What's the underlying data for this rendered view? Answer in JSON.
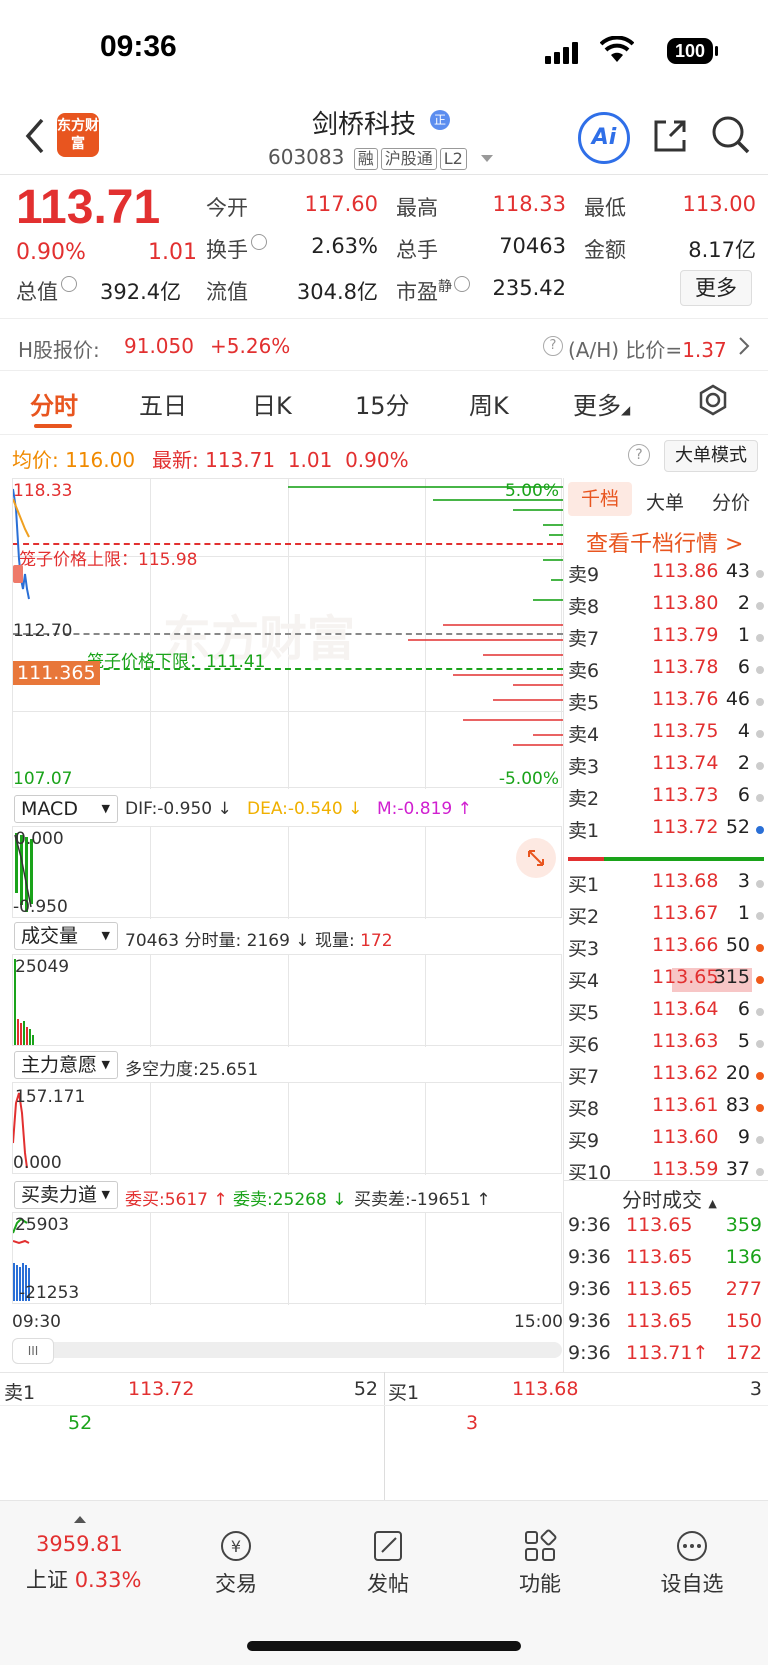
{
  "status": {
    "time": "09:36",
    "battery": "100"
  },
  "header": {
    "stock_name": "剑桥科技",
    "reg_badge": "正",
    "code": "603083",
    "tags": [
      "融",
      "沪股通",
      "L2"
    ],
    "logo_text": "东方财富",
    "ai_label": "Ai"
  },
  "quote": {
    "price": "113.71",
    "pct": "0.90%",
    "chg": "1.01",
    "open_label": "今开",
    "open": "117.60",
    "high_label": "最高",
    "high": "118.33",
    "low_label": "最低",
    "low": "113.00",
    "turn_label": "换手",
    "turn": "2.63%",
    "vol_label": "总手",
    "vol": "70463",
    "amt_label": "金额",
    "amt": "8.17亿",
    "mcap_label": "总值",
    "mcap": "392.4亿",
    "float_label": "流值",
    "float": "304.8亿",
    "pe_label": "市盈",
    "pe_sup": "静",
    "pe": "235.42",
    "more": "更多"
  },
  "hshare": {
    "label": "H股报价:",
    "price": "91.050",
    "pct": "+5.26%",
    "ratio_label": "(A/H) 比价=",
    "ratio": "1.37"
  },
  "tabs": [
    "分时",
    "五日",
    "日K",
    "15分",
    "周K",
    "更多"
  ],
  "chart": {
    "avg_label": "均价:",
    "avg": "116.00",
    "latest_label": "最新:",
    "latest": "113.71",
    "latest_chg": "1.01",
    "latest_pct": "0.90%",
    "mode_button": "大单模式",
    "y_max": "118.33",
    "y_mid": "112.70",
    "y_min": "107.07",
    "pct_max": "5.00%",
    "pct_min": "-5.00%",
    "upper_limit_text": "笼子价格上限：115.98",
    "lower_limit_text": "笼子价格下限：111.41",
    "cursor_price": "111.365",
    "watermark": "东方财富",
    "time_start": "09:30",
    "time_end": "15:00"
  },
  "macd": {
    "name": "MACD",
    "dif": "DIF:-0.950 ↓",
    "dea": "DEA:-0.540 ↓",
    "m": "M:-0.819 ↑",
    "top": "0.000",
    "bottom": "-0.950"
  },
  "volume": {
    "name": "成交量",
    "total": "70463",
    "min_vol": "分时量: 2169 ↓",
    "cur_label": "现量:",
    "cur": "172",
    "top": "25049"
  },
  "main_force": {
    "name": "主力意愿",
    "text": "多空力度:25.651",
    "top": "157.171",
    "bottom": "0.000"
  },
  "bid_ask_force": {
    "name": "买卖力道",
    "buy": "委买:5617 ↑",
    "sell": "委卖:25268 ↓",
    "diff": "买卖差:-19651 ↑",
    "top": "25903",
    "bottom": "-21253"
  },
  "orderbook": {
    "tabs": [
      "千档",
      "大单",
      "分价"
    ],
    "view_link": "查看千档行情 >",
    "asks": [
      {
        "label": "卖9",
        "price": "113.86",
        "vol": "43",
        "dot": "#cccccc"
      },
      {
        "label": "卖8",
        "price": "113.80",
        "vol": "2",
        "dot": "#cccccc"
      },
      {
        "label": "卖7",
        "price": "113.79",
        "vol": "1",
        "dot": "#cccccc"
      },
      {
        "label": "卖6",
        "price": "113.78",
        "vol": "6",
        "dot": "#cccccc"
      },
      {
        "label": "卖5",
        "price": "113.76",
        "vol": "46",
        "dot": "#cccccc"
      },
      {
        "label": "卖4",
        "price": "113.75",
        "vol": "4",
        "dot": "#cccccc"
      },
      {
        "label": "卖3",
        "price": "113.74",
        "vol": "2",
        "dot": "#cccccc"
      },
      {
        "label": "卖2",
        "price": "113.73",
        "vol": "6",
        "dot": "#cccccc"
      },
      {
        "label": "卖1",
        "price": "113.72",
        "vol": "52",
        "dot": "#2a6fd6"
      }
    ],
    "bids": [
      {
        "label": "买1",
        "price": "113.68",
        "vol": "3",
        "dot": "#cccccc"
      },
      {
        "label": "买2",
        "price": "113.67",
        "vol": "1",
        "dot": "#cccccc"
      },
      {
        "label": "买3",
        "price": "113.66",
        "vol": "50",
        "dot": "#f05a1a"
      },
      {
        "label": "买4",
        "price": "113.65",
        "vol": "315",
        "dot": "#f05a1a"
      },
      {
        "label": "买5",
        "price": "113.64",
        "vol": "6",
        "dot": "#cccccc"
      },
      {
        "label": "买6",
        "price": "113.63",
        "vol": "5",
        "dot": "#cccccc"
      },
      {
        "label": "买7",
        "price": "113.62",
        "vol": "20",
        "dot": "#f05a1a"
      },
      {
        "label": "买8",
        "price": "113.61",
        "vol": "83",
        "dot": "#f05a1a"
      },
      {
        "label": "买9",
        "price": "113.60",
        "vol": "9",
        "dot": "#cccccc"
      },
      {
        "label": "买10",
        "price": "113.59",
        "vol": "37",
        "dot": "#cccccc"
      }
    ],
    "trades_title": "分时成交",
    "trades": [
      {
        "time": "9:36",
        "price": "113.65",
        "vol": "359",
        "color": "#1aa31a"
      },
      {
        "time": "9:36",
        "price": "113.65",
        "vol": "136",
        "color": "#1aa31a"
      },
      {
        "time": "9:36",
        "price": "113.65",
        "vol": "277",
        "color": "#e23030"
      },
      {
        "time": "9:36",
        "price": "113.65",
        "vol": "150",
        "color": "#e23030"
      },
      {
        "time": "9:36",
        "price": "113.71↑",
        "vol": "172",
        "color": "#e23030"
      }
    ]
  },
  "bottom_quote": {
    "sell_label": "卖1",
    "sell_price": "113.72",
    "sell_vol": "52",
    "buy_label": "买1",
    "buy_price": "113.68",
    "buy_vol": "3",
    "sell_queue": "52",
    "buy_queue": "3"
  },
  "nav": {
    "index_value": "3959.81",
    "index_name": "上证",
    "index_pct": "0.33%",
    "items": [
      "交易",
      "发帖",
      "功能",
      "设自选"
    ]
  },
  "colors": {
    "red": "#e23030",
    "green": "#1aa31a",
    "orange": "#f08a00",
    "brand": "#e8551f"
  }
}
